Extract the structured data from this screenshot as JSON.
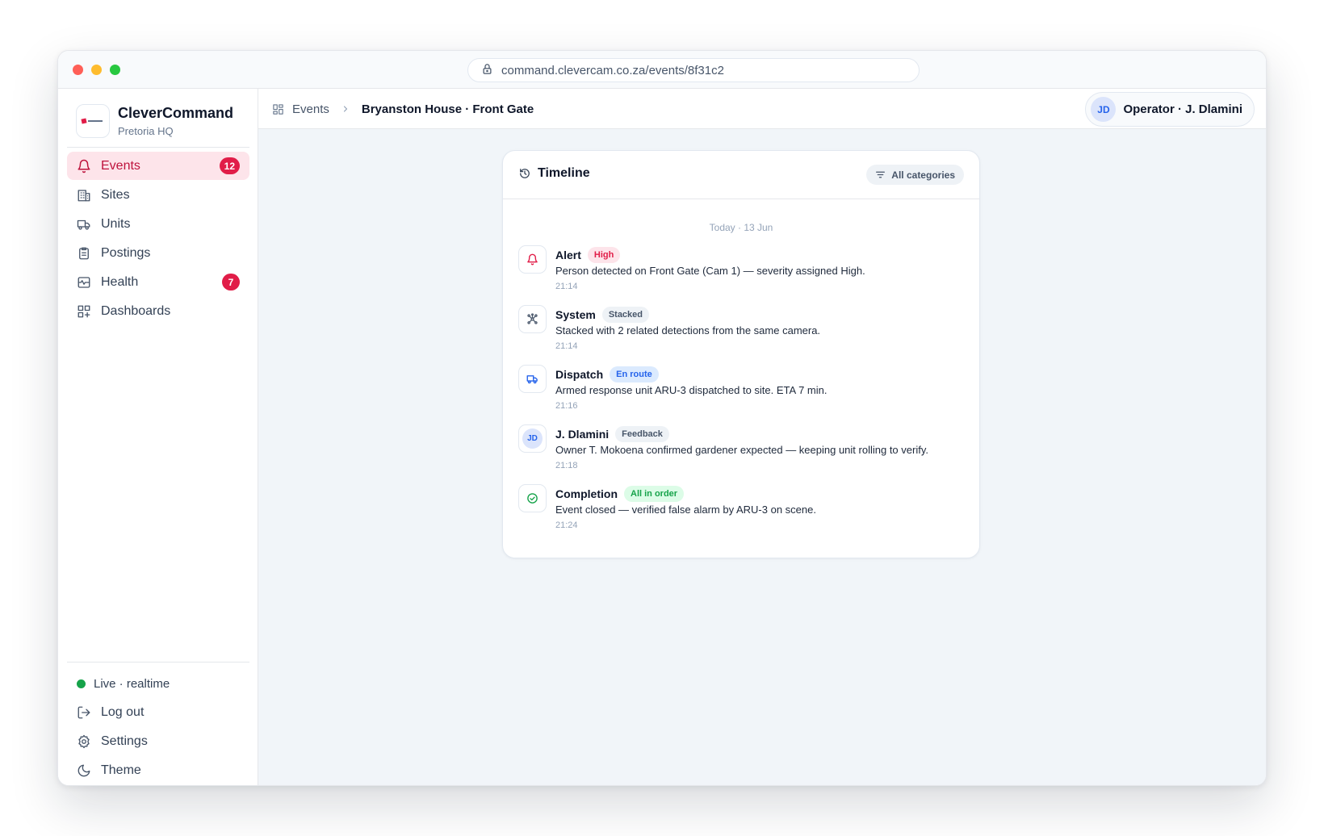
{
  "browser": {
    "url": "command.clevercam.co.za/events/8f31c2"
  },
  "brand": {
    "name": "CleverCommand",
    "subtitle": "Pretoria HQ"
  },
  "sidebar": {
    "items": [
      {
        "label": "Events",
        "icon": "bell-icon",
        "badge": "12",
        "active": true
      },
      {
        "label": "Sites",
        "icon": "building-icon"
      },
      {
        "label": "Units",
        "icon": "truck-icon"
      },
      {
        "label": "Postings",
        "icon": "clipboard-icon"
      },
      {
        "label": "Health",
        "icon": "pulse-icon",
        "badge": "7"
      },
      {
        "label": "Dashboards",
        "icon": "dashboard-grid-icon"
      }
    ],
    "status": "Live · realtime",
    "bottom": [
      {
        "label": "Log out",
        "icon": "logout-icon"
      },
      {
        "label": "Settings",
        "icon": "gear-icon"
      },
      {
        "label": "Theme",
        "icon": "moon-icon"
      }
    ]
  },
  "header": {
    "breadcrumb_root": "Events",
    "breadcrumb_current": "Bryanston House · Front Gate",
    "operator_initials": "JD",
    "operator_label": "Operator · J. Dlamini"
  },
  "timeline": {
    "title": "Timeline",
    "filter": "All categories",
    "day": "Today · 13 Jun",
    "events": [
      {
        "title": "Alert",
        "tag": "High",
        "desc": "Person detected on Front Gate (Cam 1) — severity assigned High.",
        "time": "21:14"
      },
      {
        "title": "System",
        "tag": "Stacked",
        "desc": "Stacked with 2 related detections from the same camera.",
        "time": "21:14"
      },
      {
        "title": "Dispatch",
        "tag": "En route",
        "desc": "Armed response unit ARU-3 dispatched to site. ETA 7 min.",
        "time": "21:16"
      },
      {
        "title": "J. Dlamini",
        "tag": "Feedback",
        "desc": "Owner T. Mokoena confirmed gardener expected — keeping unit rolling to verify.",
        "time": "21:18",
        "initials": "JD"
      },
      {
        "title": "Completion",
        "tag": "All in order",
        "desc": "Event closed — verified false alarm by ARU-3 on scene.",
        "time": "21:24"
      }
    ]
  },
  "colors": {
    "accent": "#e11d48",
    "active_bg": "#fde4ea",
    "high_tag_bg": "#fde4ea",
    "high_tag_text": "#e11d48",
    "enroute_tag_bg": "#dbeafe",
    "enroute_tag_text": "#2563eb",
    "neutral_tag_bg": "#eef2f6",
    "neutral_tag_text": "#475569",
    "ok_tag_bg": "#dcfce7",
    "ok_tag_text": "#16a34a"
  }
}
